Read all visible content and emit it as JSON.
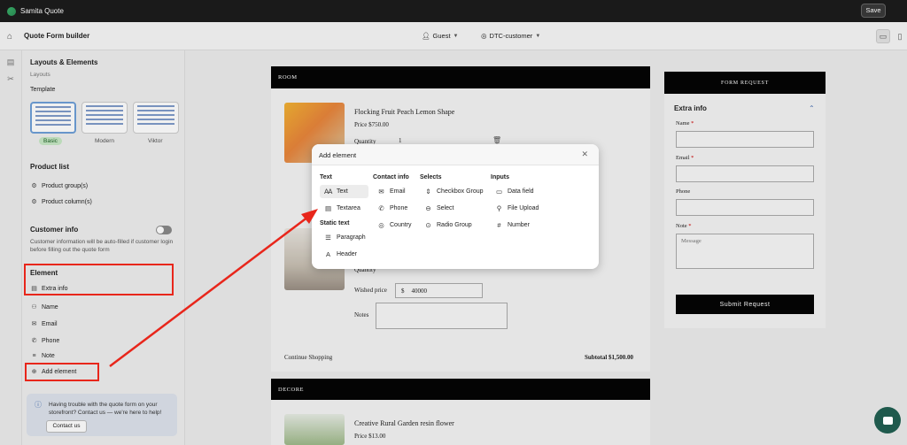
{
  "app": {
    "name": "Samita Quote",
    "save_label": "Save"
  },
  "header": {
    "title": "Quote Form builder",
    "guest_label": "Guest",
    "customer_label": "DTC-customer"
  },
  "sidebar": {
    "title": "Layouts & Elements",
    "layouts_label": "Layouts",
    "template_label": "Template",
    "templates": [
      {
        "label": "Basic",
        "selected": true
      },
      {
        "label": "Modern",
        "selected": false
      },
      {
        "label": "Viktor",
        "selected": false
      }
    ],
    "product_list": {
      "title": "Product list",
      "items": [
        "Product group(s)",
        "Product column(s)"
      ]
    },
    "customer_info": {
      "title": "Customer info",
      "description": "Customer information will be auto-filled if customer login before filling out the quote form"
    },
    "element": {
      "title": "Element",
      "items": [
        "Extra info",
        "Name",
        "Email",
        "Phone",
        "Note",
        "Add element"
      ]
    },
    "help": {
      "text": "Having trouble with the quote form on your storefront? Contact us — we're here to help!",
      "button": "Contact us"
    }
  },
  "canvas": {
    "room_title": "ROOM",
    "product1": {
      "name": "Flocking Fruit Peach Lemon Shape",
      "price": "Price  $750.00",
      "qty_label": "Quantity",
      "qty": "1"
    },
    "product2": {
      "qty_label": "Quantity",
      "wished_label": "Wished price",
      "currency": "$",
      "wished_value": "40000",
      "notes_label": "Notes"
    },
    "continue": "Continue Shopping",
    "subtotal": "Subtotal $1,500.00",
    "decore_title": "DECORE",
    "product3": {
      "name": "Creative Rural Garden resin flower",
      "price": "Price  $13.00"
    }
  },
  "form": {
    "title": "FORM REQUEST",
    "section": "Extra info",
    "fields": [
      {
        "label": "Name",
        "required": true
      },
      {
        "label": "Email",
        "required": true
      },
      {
        "label": "Phone",
        "required": false
      },
      {
        "label": "Note",
        "required": true,
        "placeholder": "Message"
      }
    ],
    "submit": "Submit Request"
  },
  "modal": {
    "title": "Add element",
    "groups": {
      "text": {
        "title": "Text",
        "items": [
          "Text",
          "Textarea"
        ]
      },
      "static": {
        "title": "Static text",
        "items": [
          "Paragraph",
          "Header"
        ]
      },
      "contact": {
        "title": "Contact info",
        "items": [
          "Email",
          "Phone",
          "Country"
        ]
      },
      "selects": {
        "title": "Selects",
        "items": [
          "Checkbox Group",
          "Select",
          "Radio Group"
        ]
      },
      "inputs": {
        "title": "Inputs",
        "items": [
          "Data field",
          "File Upload",
          "Number"
        ]
      }
    }
  },
  "colors": {
    "highlight": "#e8261b",
    "brand": "#1f5a4d",
    "selected_tag": "#c7e8c5"
  }
}
